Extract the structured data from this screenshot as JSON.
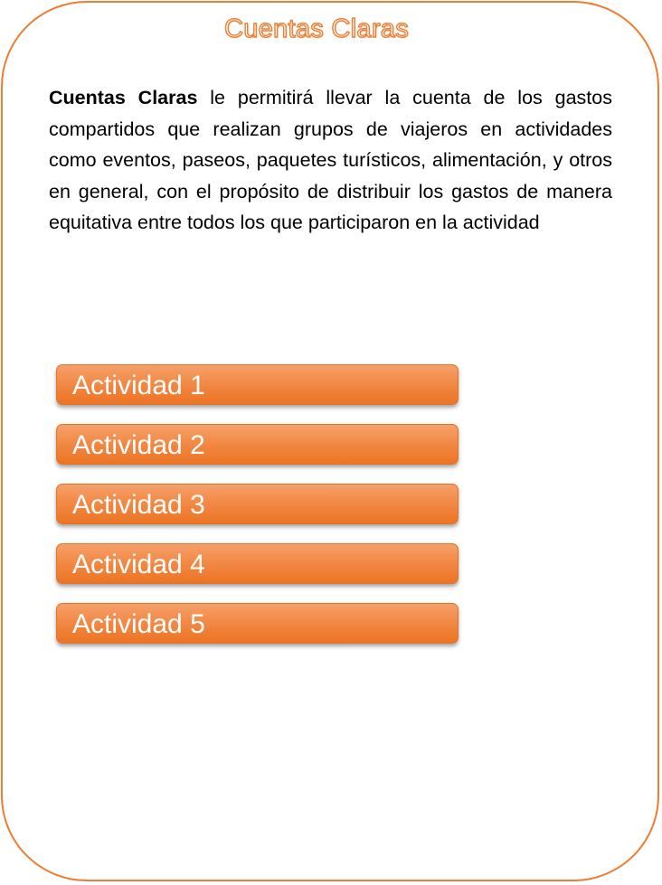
{
  "app": {
    "title": "Cuentas Claras"
  },
  "intro": {
    "brand": "Cuentas Claras",
    "text": " le permitirá llevar la cuenta de los gastos compartidos que realizan grupos de viajeros en actividades como eventos, paseos, paquetes turísticos, alimentación, y otros en general, con el propósito de distribuir los gastos de manera equitativa entre todos los que participaron en la actividad"
  },
  "activities": [
    {
      "label": "Actividad 1"
    },
    {
      "label": "Actividad 2"
    },
    {
      "label": "Actividad 3"
    },
    {
      "label": "Actividad 4"
    },
    {
      "label": "Actividad 5"
    }
  ],
  "colors": {
    "accent": "#ED7D31",
    "button_text": "#FFFFFF"
  }
}
